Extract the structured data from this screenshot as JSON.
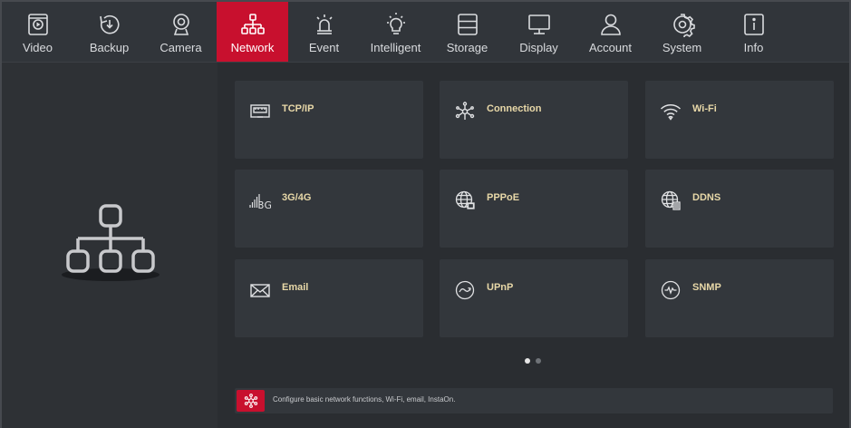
{
  "nav": {
    "items": [
      {
        "label": "Video",
        "icon": "video-icon"
      },
      {
        "label": "Backup",
        "icon": "backup-icon"
      },
      {
        "label": "Camera",
        "icon": "camera-icon"
      },
      {
        "label": "Network",
        "icon": "network-icon",
        "active": true
      },
      {
        "label": "Event",
        "icon": "event-alarm-icon"
      },
      {
        "label": "Intelligent",
        "icon": "intelligent-bulb-icon"
      },
      {
        "label": "Storage",
        "icon": "storage-icon"
      },
      {
        "label": "Display",
        "icon": "display-monitor-icon"
      },
      {
        "label": "Account",
        "icon": "account-user-icon"
      },
      {
        "label": "System",
        "icon": "system-gear-icon"
      },
      {
        "label": "Info",
        "icon": "info-icon"
      }
    ]
  },
  "tiles": [
    {
      "label": "TCP/IP",
      "icon": "ethernet-port-icon"
    },
    {
      "label": "Connection",
      "icon": "connection-hub-icon"
    },
    {
      "label": "Wi-Fi",
      "icon": "wifi-icon"
    },
    {
      "label": "3G/4G",
      "icon": "signal-3g-icon"
    },
    {
      "label": "PPPoE",
      "icon": "globe-pppoe-icon"
    },
    {
      "label": "DDNS",
      "icon": "globe-ddns-icon"
    },
    {
      "label": "Email",
      "icon": "envelope-icon"
    },
    {
      "label": "UPnP",
      "icon": "upnp-icon"
    },
    {
      "label": "SNMP",
      "icon": "snmp-wave-icon"
    }
  ],
  "pagination": {
    "pages": 2,
    "current": 1
  },
  "infobar": {
    "text": "Configure basic network functions, Wi-Fi, email, InstaOn."
  },
  "colors": {
    "accent": "#c8102e",
    "tile_label": "#e8d8a8",
    "background": "#2a2d31"
  }
}
